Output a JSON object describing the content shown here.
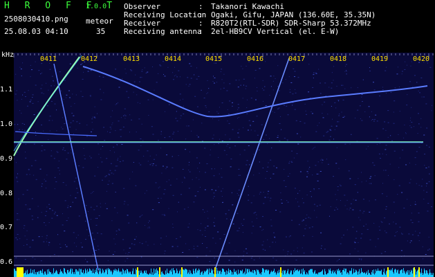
{
  "header": {
    "app_title": "H R O F F T",
    "app_version": "1.0.0",
    "file_name": "2508030410.png",
    "detect_label": "meteor",
    "date_time": "25.08.03 04:10",
    "detect_count": "35",
    "info": [
      {
        "label": "Observer",
        "value": "Takanori Kawachi"
      },
      {
        "label": "Receiving Location",
        "value": "Ogaki, Gifu, JAPAN (136.60E, 35.35N)"
      },
      {
        "label": "Receiver",
        "value": "R820T2(RTL-SDR) SDR-Sharp 53.372MHz"
      },
      {
        "label": "Receiving antenna",
        "value": "2el-HB9CV Vertical (el. E-W)"
      }
    ],
    "separator": ":"
  },
  "spectrogram": {
    "unit_label": "kHz",
    "time_ticks": [
      "0411",
      "0412",
      "0413",
      "0414",
      "0415",
      "0416",
      "0417",
      "0418",
      "0419",
      "0420"
    ],
    "freq_ticks": [
      "1.1",
      "1.0",
      "0.9",
      "0.8",
      "0.7",
      "0.6"
    ],
    "colors": {
      "background": "#0a0a3a",
      "signal": "#5a7cff",
      "carrier": "#7fffc0",
      "level_bar": "#19c8ff",
      "peak": "#ffff00",
      "tick_text": "#ffe000"
    }
  }
}
